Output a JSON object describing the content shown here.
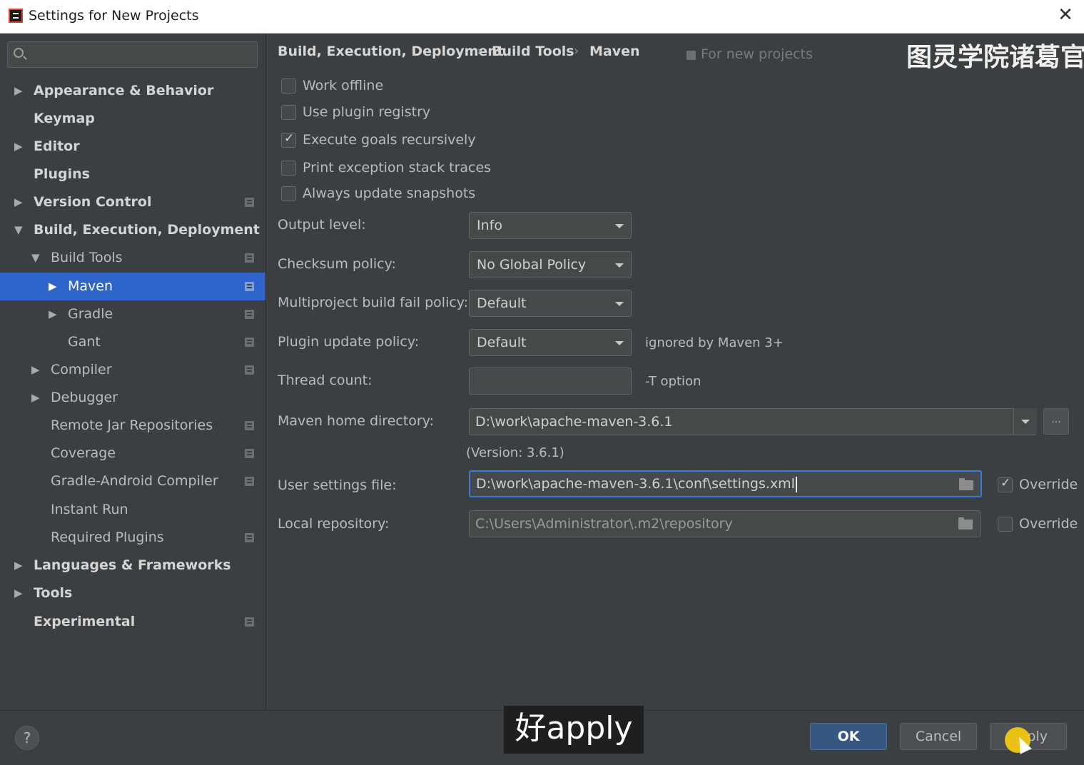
{
  "window": {
    "title": "Settings for New Projects",
    "close_glyph": "✕"
  },
  "sidebar": {
    "search_placeholder": "",
    "items": [
      {
        "label": "Appearance & Behavior",
        "arrow": "▶"
      },
      {
        "label": "Keymap"
      },
      {
        "label": "Editor",
        "arrow": "▶"
      },
      {
        "label": "Plugins"
      },
      {
        "label": "Version Control",
        "arrow": "▶"
      },
      {
        "label": "Build, Execution, Deployment",
        "arrow": "▼"
      },
      {
        "label": "Build Tools",
        "arrow": "▼"
      },
      {
        "label": "Maven",
        "arrow": "▶"
      },
      {
        "label": "Gradle",
        "arrow": "▶"
      },
      {
        "label": "Gant"
      },
      {
        "label": "Compiler",
        "arrow": "▶"
      },
      {
        "label": "Debugger",
        "arrow": "▶"
      },
      {
        "label": "Remote Jar Repositories"
      },
      {
        "label": "Coverage"
      },
      {
        "label": "Gradle-Android Compiler"
      },
      {
        "label": "Instant Run"
      },
      {
        "label": "Required Plugins"
      },
      {
        "label": "Languages & Frameworks",
        "arrow": "▶"
      },
      {
        "label": "Tools",
        "arrow": "▶"
      },
      {
        "label": "Experimental"
      }
    ]
  },
  "breadcrumb": {
    "items": [
      "Build, Execution, Deployment",
      "Build Tools",
      "Maven"
    ],
    "separator": "›",
    "scope_note": "For new projects"
  },
  "watermark": "图灵学院诸葛官",
  "maven": {
    "checkboxes": [
      {
        "label": "Work offline",
        "checked": false
      },
      {
        "label": "Use plugin registry",
        "checked": false
      },
      {
        "label": "Execute goals recursively",
        "checked": true
      },
      {
        "label": "Print exception stack traces",
        "checked": false
      },
      {
        "label": "Always update snapshots",
        "checked": false
      }
    ],
    "output_level": {
      "label": "Output level:",
      "value": "Info"
    },
    "checksum_policy": {
      "label": "Checksum policy:",
      "value": "No Global Policy"
    },
    "multiproject_fail_policy": {
      "label": "Multiproject build fail policy:",
      "value": "Default"
    },
    "plugin_update_policy": {
      "label": "Plugin update policy:",
      "value": "Default",
      "hint": "ignored by Maven 3+"
    },
    "thread_count": {
      "label": "Thread count:",
      "value": "",
      "hint": "-T option"
    },
    "home_directory": {
      "label": "Maven home directory:",
      "value": "D:\\work\\apache-maven-3.6.1",
      "browse": "...",
      "version": "(Version: 3.6.1)"
    },
    "user_settings": {
      "label": "User settings file:",
      "value": "D:\\work\\apache-maven-3.6.1\\conf\\settings.xml",
      "override_label": "Override",
      "override": true
    },
    "local_repository": {
      "label": "Local repository:",
      "value": "C:\\Users\\Administrator\\.m2\\repository",
      "override_label": "Override",
      "override": false
    }
  },
  "footer": {
    "help": "?",
    "subtitle": "好apply",
    "ok": "OK",
    "cancel": "Cancel",
    "apply_visible": "ply"
  }
}
